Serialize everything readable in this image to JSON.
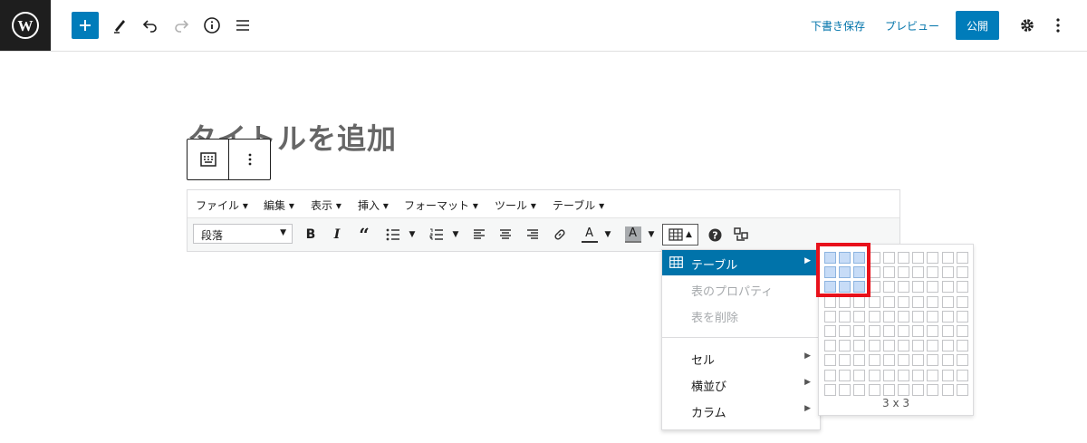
{
  "topbar": {
    "draft_save": "下書き保存",
    "preview": "プレビュー",
    "publish": "公開"
  },
  "editor": {
    "title_placeholder": "タイトルを追加",
    "menus": [
      "ファイル ▾",
      "編集 ▾",
      "表示 ▾",
      "挿入 ▾",
      "フォーマット ▾",
      "ツール ▾",
      "テーブル ▾"
    ],
    "format_select": "段落"
  },
  "table_menu": {
    "items": [
      {
        "label": "テーブル",
        "state": "active",
        "submenu": true
      },
      {
        "label": "表のプロパティ",
        "state": "disabled",
        "submenu": false
      },
      {
        "label": "表を削除",
        "state": "disabled",
        "submenu": false
      },
      {
        "label": "セル",
        "state": "normal",
        "submenu": true
      },
      {
        "label": "横並び",
        "state": "normal",
        "submenu": true
      },
      {
        "label": "カラム",
        "state": "normal",
        "submenu": true
      }
    ]
  },
  "grid_picker": {
    "rows": 10,
    "cols": 10,
    "selected_rows": 3,
    "selected_cols": 3,
    "size_label": "3 x 3"
  },
  "colors": {
    "accent": "#007cba",
    "highlight": "#e8111b"
  }
}
